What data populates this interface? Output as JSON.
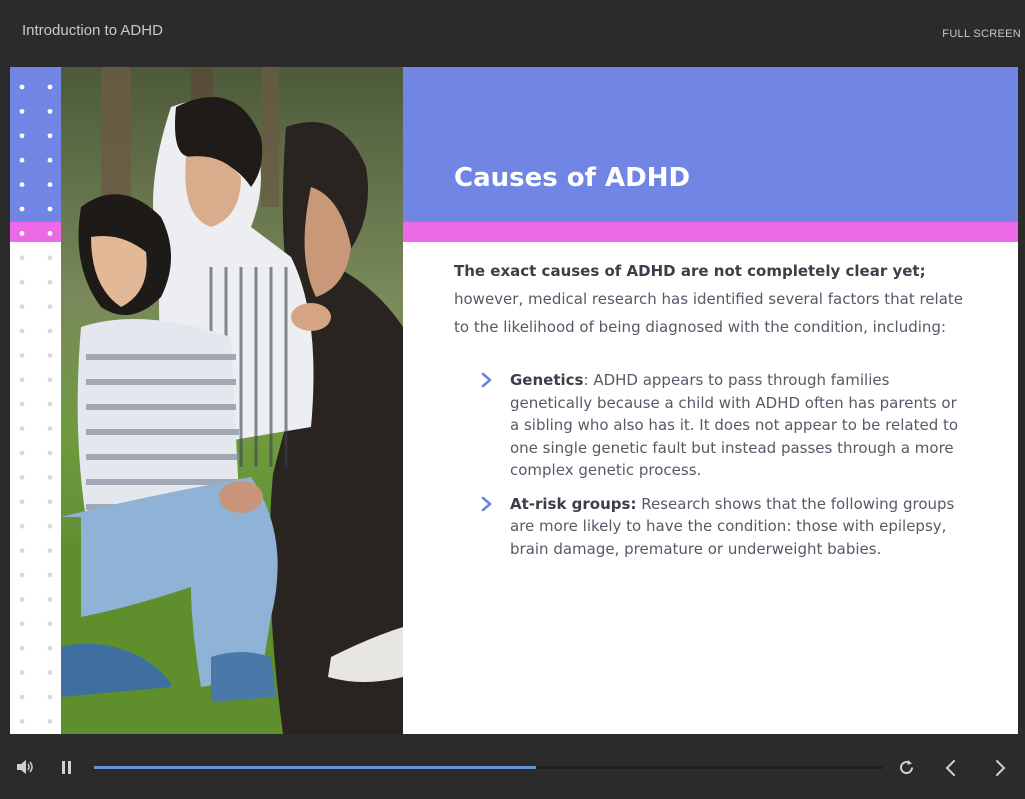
{
  "header": {
    "course_title": "Introduction to ADHD",
    "fullscreen_label": "FULL SCREEN"
  },
  "slide": {
    "title": "Causes of ADHD",
    "intro_bold": "The exact causes of ADHD are not completely clear yet;",
    "intro_rest": " however, medical research has identified several factors that relate to the likelihood of being diagnosed with the condition, including:",
    "bullets": [
      {
        "term": "Genetics",
        "separator": ": ",
        "text": "ADHD appears to pass through families genetically because a child with ADHD often has parents or a sibling who also has it. It does not appear to be related to one single genetic fault but instead passes through a more complex genetic process."
      },
      {
        "term": "At-risk groups:",
        "separator": " ",
        "text": "Research shows that the following groups are more likely to have the condition: those with epilepsy, brain damage, premature or underweight babies."
      }
    ],
    "colors": {
      "header_blue": "#7085e4",
      "accent_pink": "#ec6ae8",
      "chevron": "#6b84e0"
    }
  },
  "player": {
    "progress": 0.56,
    "icons": [
      "volume-icon",
      "pause-icon",
      "replay-icon",
      "chevron-left-icon",
      "chevron-right-icon"
    ]
  }
}
